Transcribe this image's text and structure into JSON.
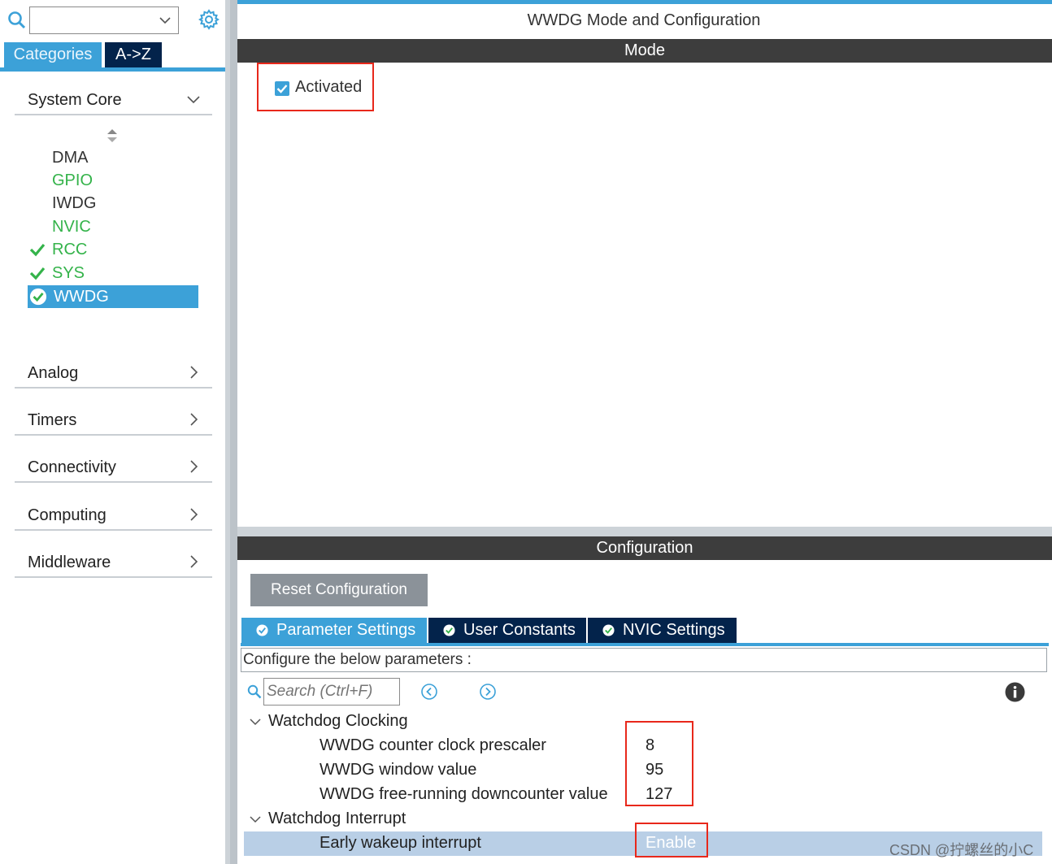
{
  "left_panel": {
    "search_combo_value": "",
    "tabs": {
      "categories": "Categories",
      "az": "A->Z"
    },
    "categories": {
      "system_core": "System Core",
      "analog": "Analog",
      "timers": "Timers",
      "connectivity": "Connectivity",
      "computing": "Computing",
      "middleware": "Middleware"
    },
    "peripherals": [
      {
        "label": "DMA",
        "state": "plain"
      },
      {
        "label": "GPIO",
        "state": "configured"
      },
      {
        "label": "IWDG",
        "state": "plain"
      },
      {
        "label": "NVIC",
        "state": "configured"
      },
      {
        "label": "RCC",
        "state": "checked"
      },
      {
        "label": "SYS",
        "state": "checked"
      },
      {
        "label": "WWDG",
        "state": "selected"
      }
    ]
  },
  "right_panel": {
    "title": "WWDG Mode and Configuration",
    "mode_header": "Mode",
    "activated_label": "Activated",
    "activated_checked": true,
    "configuration_header": "Configuration",
    "reset_button": "Reset Configuration",
    "tabs": [
      {
        "label": "Parameter Settings",
        "active": true
      },
      {
        "label": "User Constants",
        "active": false
      },
      {
        "label": "NVIC Settings",
        "active": false
      }
    ],
    "configure_text": "Configure the below parameters :",
    "search_placeholder": "Search (Ctrl+F)",
    "groups": {
      "clocking": {
        "title": "Watchdog Clocking",
        "params": [
          {
            "name": "WWDG counter clock prescaler",
            "value": "8"
          },
          {
            "name": "WWDG window value",
            "value": "95"
          },
          {
            "name": "WWDG free-running downcounter value",
            "value": "127"
          }
        ]
      },
      "interrupt": {
        "title": "Watchdog Interrupt",
        "params": [
          {
            "name": "Early wakeup interrupt",
            "value": "Enable"
          }
        ]
      }
    }
  },
  "watermark": "CSDN @拧螺丝的小C",
  "colors": {
    "accent_blue": "#3ca1d8",
    "navy_tab": "#03234b",
    "header_band": "#3d3d3d",
    "configured_green": "#34b34a",
    "highlight_red": "#e8281b"
  }
}
